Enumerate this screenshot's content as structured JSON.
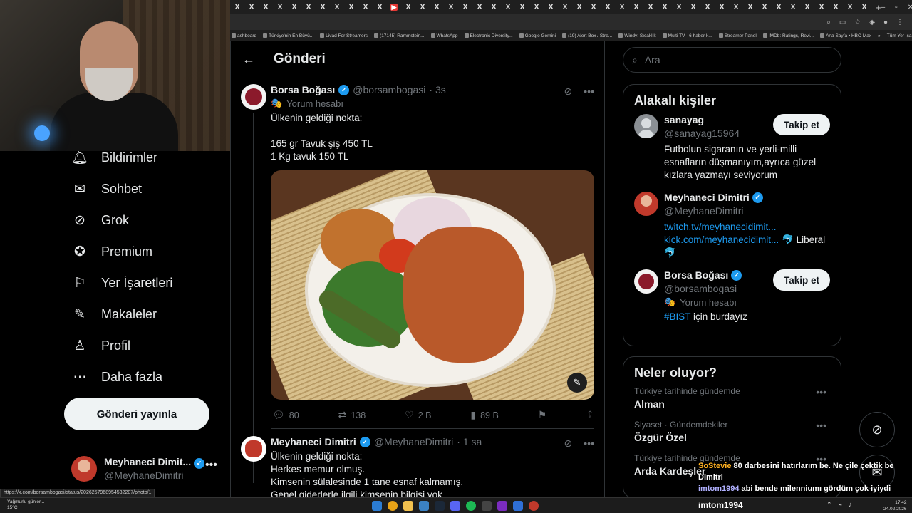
{
  "browser": {
    "tab_labels": [
      "X",
      "X",
      "X",
      "X",
      "X",
      "X",
      "X",
      "X",
      "X",
      "X",
      "X",
      "X",
      "X",
      "X",
      "X",
      "X",
      "X",
      "X",
      "X",
      "X",
      "X",
      "X",
      "X",
      "X",
      "X",
      "X",
      "X",
      "X",
      "X",
      "X",
      "X",
      "X",
      "X",
      "X",
      "X",
      "X",
      "X",
      "X",
      "X",
      "X",
      "X",
      "X",
      "X",
      "X",
      "X"
    ],
    "bookmarks": [
      "ashboard",
      "Türkiye'nin En Büyü...",
      "Livad For Streamers",
      "(17145) Rammstein...",
      "WhatsApp",
      "Electronic Diversity...",
      "Google Gemini",
      "(19) Alert Box / Stre...",
      "Windy: Sıcaklık",
      "Multi TV - 6 haber k...",
      "Streamer Panel",
      "IMDb: Ratings, Revi...",
      "Ana Sayfa • HBO Max"
    ],
    "bookmarks_all": "Tüm Yer İşaretleri",
    "status_url": "https://x.com/borsambogasi/status/2026257968954532207/photo/1"
  },
  "nav": {
    "items": [
      {
        "label": "Bildirimler",
        "icon": "bell-icon"
      },
      {
        "label": "Sohbet",
        "icon": "mail-icon"
      },
      {
        "label": "Grok",
        "icon": "grok-icon"
      },
      {
        "label": "Premium",
        "icon": "verified-badge-icon"
      },
      {
        "label": "Yer İşaretleri",
        "icon": "bookmark-icon"
      },
      {
        "label": "Makaleler",
        "icon": "article-icon"
      },
      {
        "label": "Profil",
        "icon": "person-icon"
      },
      {
        "label": "Daha fazla",
        "icon": "more-circle-icon"
      }
    ],
    "post_button": "Gönderi yayınla",
    "account": {
      "name": "Meyhaneci Dimit...",
      "handle": "@MeyhaneDimitri"
    }
  },
  "main": {
    "title": "Gönderi",
    "tweet": {
      "name": "Borsa Boğası",
      "handle": "@borsambogasi",
      "time": "· 3s",
      "label": "Yorum hesabı",
      "text": "Ülkenin geldiği nokta:\n\n165 gr Tavuk şiş 450 TL\n1 Kg tavuk 150 TL",
      "stats": {
        "replies": "80",
        "reposts": "138",
        "likes": "2 B",
        "views": "89 B"
      }
    },
    "tweet2": {
      "name": "Meyhaneci Dimitri",
      "handle": "@MeyhaneDimitri",
      "time": "· 1 sa",
      "text": "Ülkenin geldiği nokta:\nHerkes memur olmuş.\nKimsenin sülalesinde 1 tane esnaf kalmamış.\nGenel giderlerle ilgili kimsenin bilgisi yok."
    }
  },
  "right": {
    "search_placeholder": "Ara",
    "related_title": "Alakalı kişiler",
    "people": [
      {
        "name": "sanayag",
        "handle": "@sanayag15964",
        "bio": "Futbolun sigaranın ve yerli-milli esnafların düşmanıyım,ayrıca güzel kızlara yazmayı seviyorum",
        "follow": "Takip et"
      },
      {
        "name": "Meyhaneci Dimitri",
        "handle": "@MeyhaneDimitri",
        "link1": "twitch.tv/meyhanecidimit...",
        "link2": "kick.com/meyhanecidimit...",
        "bio_suffix": "🐬 Liberal",
        "bio_line2": "🐬"
      },
      {
        "name": "Borsa Boğası",
        "handle": "@borsambogasi",
        "label": "Yorum hesabı",
        "hashtag": "#BIST",
        "bio_suffix": " için burdayız",
        "follow": "Takip et"
      }
    ],
    "trends_title": "Neler oluyor?",
    "trends": [
      {
        "meta": "Türkiye tarihinde gündemde",
        "name": "Alman"
      },
      {
        "meta": "Siyaset · Gündemdekiler",
        "name": "Özgür Özel"
      },
      {
        "meta": "Türkiye tarihinde gündemde",
        "name": "Arda Kardeşler"
      }
    ]
  },
  "chat": [
    {
      "user": "SoStevie",
      "msg": "80 darbesini hatırlarım be. Ne çile çektik be Dimitri"
    },
    {
      "user": "imtom1994",
      "msg": "abi bende milenniumı gördüm çok iyiydi"
    }
  ],
  "taskbar": {
    "weather_line1": "Yağmurlu günler...",
    "weather_line2": "15°C",
    "streamer": "imtom1994",
    "time": "17:42",
    "date": "24.02.2026"
  }
}
